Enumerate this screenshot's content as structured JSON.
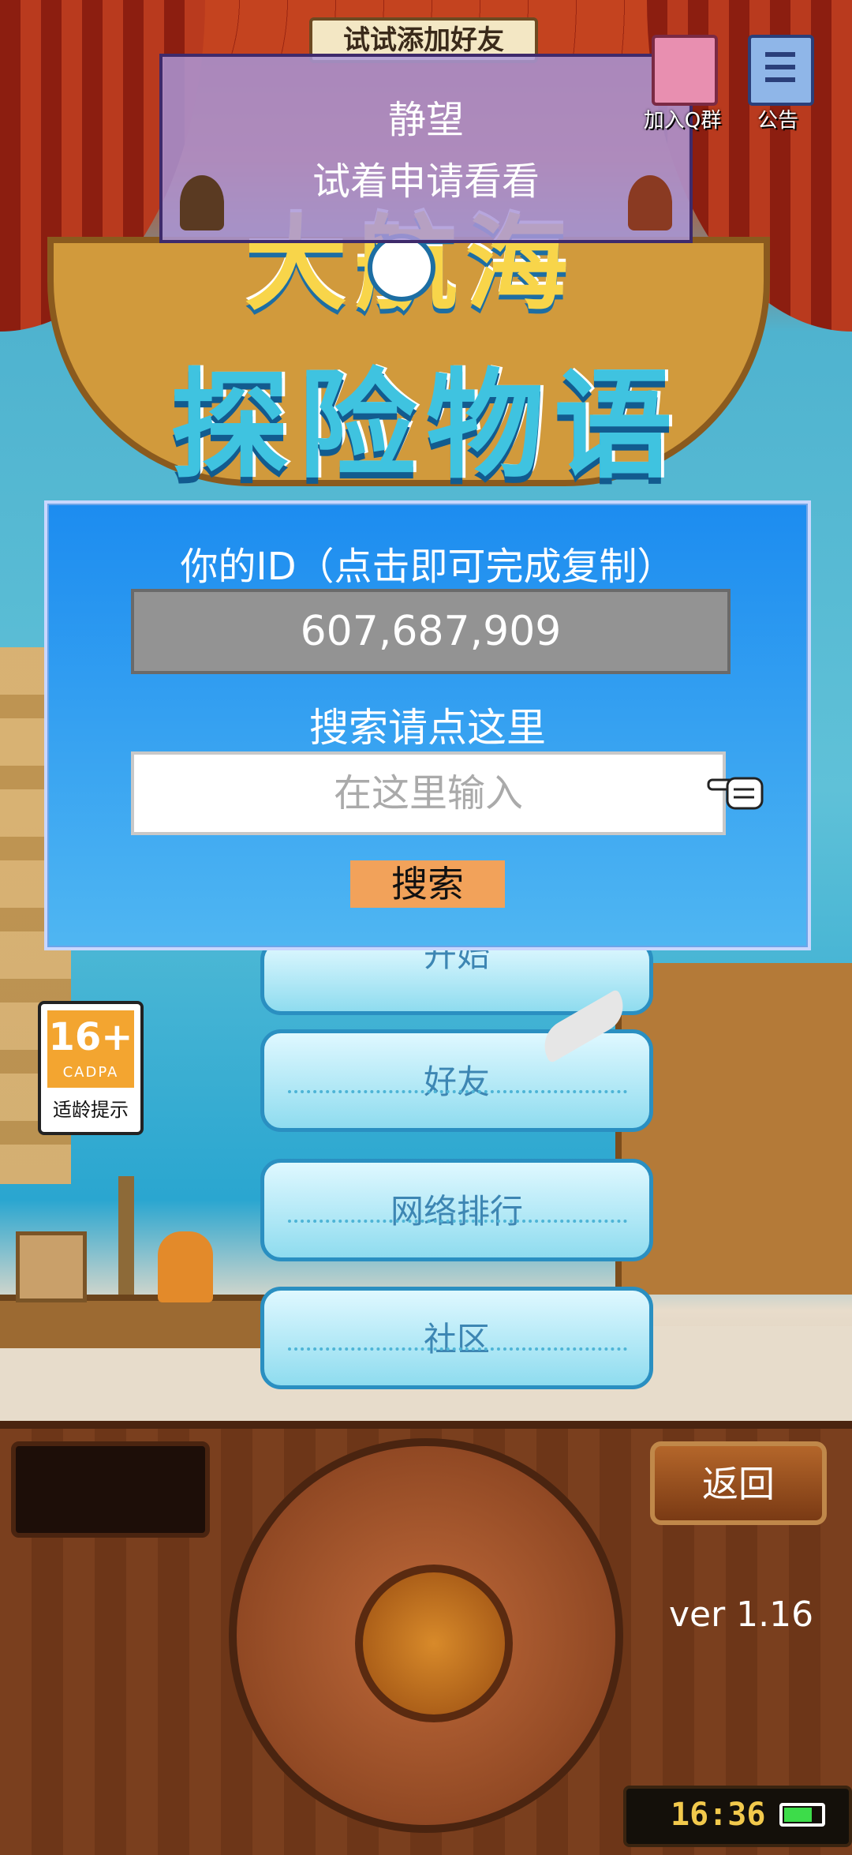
{
  "game_title": {
    "line1": "大航海",
    "line2": "探险物语"
  },
  "top_banner": {
    "friend_hint": "试试添加好友",
    "notice_name": "静望",
    "notice_message": "试着申请看看"
  },
  "top_right": {
    "qgroup_label": "加入Q群",
    "announcement_label": "公告"
  },
  "id_panel": {
    "id_title": "你的ID（点击即可完成复制）",
    "id_value": "607,687,909",
    "search_title": "搜索请点这里",
    "search_placeholder": "在这里输入",
    "search_button": "搜索"
  },
  "menu": {
    "hidden_item": "开始",
    "friends": "好友",
    "ranking": "网络排行",
    "community": "社区"
  },
  "age_rating": {
    "age": "16+",
    "org": "CADPA",
    "label": "适龄提示"
  },
  "console": {
    "back_button": "返回",
    "version": "ver 1.16",
    "clock": "16:36",
    "battery_level": 0.75
  },
  "colors": {
    "panel_top": "#1c8cf0",
    "panel_bottom": "#4fb6f2",
    "search_button": "#f2a25a",
    "id_box": "#939393"
  },
  "icons": [
    "qq-group-avatar-icon",
    "announcement-document-icon",
    "pointing-hand-icon",
    "battery-icon",
    "compass-icon"
  ]
}
